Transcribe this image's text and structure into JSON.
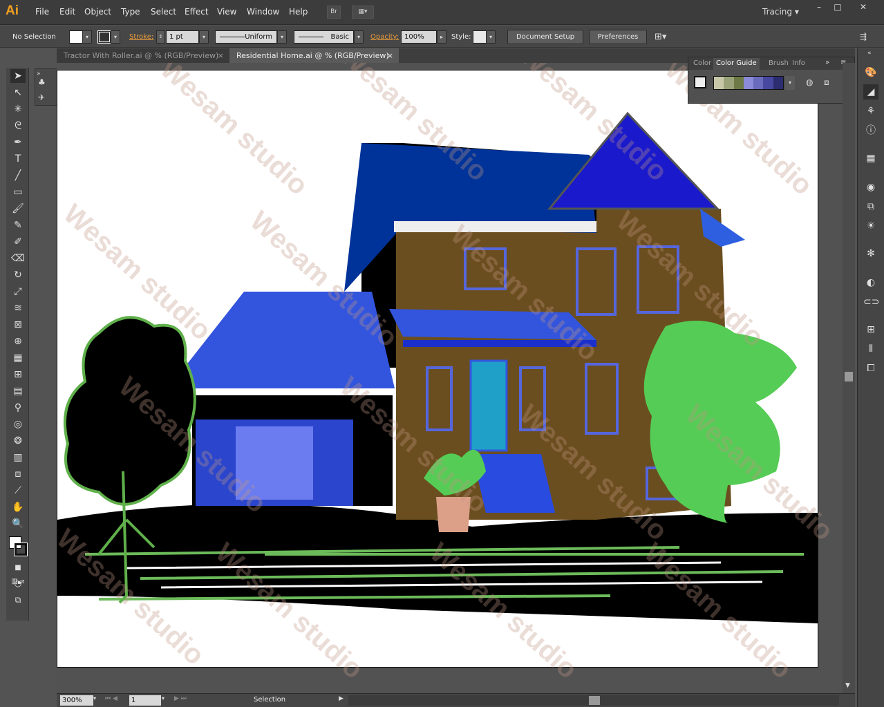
{
  "app": {
    "logo": "Ai"
  },
  "menu": [
    "File",
    "Edit",
    "Object",
    "Type",
    "Select",
    "Effect",
    "View",
    "Window",
    "Help"
  ],
  "bridge_label": "Br",
  "workspace": "Tracing",
  "window_controls": [
    "minimize-icon",
    "maximize-icon",
    "close-icon"
  ],
  "control": {
    "selection": "No Selection",
    "stroke_label": "Stroke:",
    "stroke_weight": "1 pt",
    "profile": "Uniform",
    "brush": "Basic",
    "opacity_label": "Opacity:",
    "opacity": "100%",
    "style_label": "Style:",
    "document_setup": "Document Setup",
    "preferences": "Preferences"
  },
  "tabs": [
    {
      "label": "Tractor With Roller.ai @ % (RGB/Preview)",
      "close": "×",
      "active": false
    },
    {
      "label": "Residential Home.ai @ % (RGB/Preview)",
      "close": "×",
      "active": true
    }
  ],
  "color_panel": {
    "tabs": [
      "Color",
      "Color Guide",
      "Brush",
      "Info"
    ],
    "active_tab": "Color Guide",
    "guide_colors": [
      "#c8c8a8",
      "#9aa27a",
      "#6e7a46",
      "#8a8ad8",
      "#6b6bbd",
      "#4848a0",
      "#2c2c70"
    ]
  },
  "artwork": {
    "watermark": "Wesam studio",
    "colors": {
      "roof": "#003399",
      "roof_light": "#3355dd",
      "wall": "#6b4e1f",
      "trim": "#4a5bd8",
      "plant": "#55cc55",
      "ground": "#000000"
    }
  },
  "status": {
    "zoom": "300%",
    "page": "1",
    "tool": "Selection"
  }
}
